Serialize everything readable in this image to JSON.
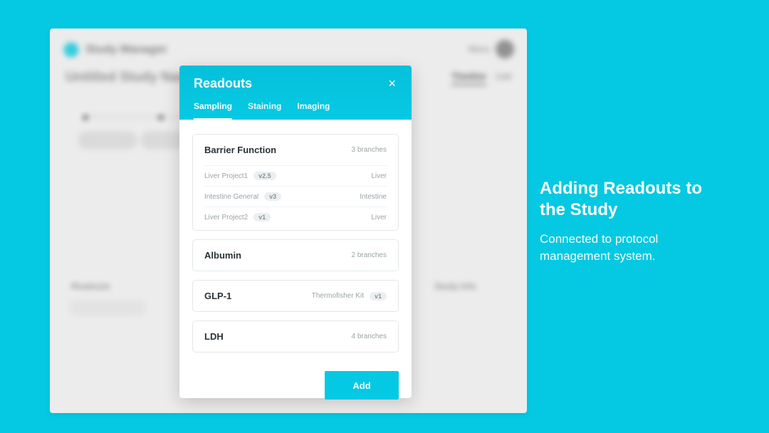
{
  "caption": {
    "title": "Adding Readouts to the Study",
    "subtitle": "Connected to protocol management system."
  },
  "bg": {
    "app_name": "Study Manager",
    "menu_label": "Menu",
    "doc_title": "Untitled Study Name",
    "right_tabs": {
      "active": "Timeline",
      "inactive": "List"
    },
    "section_readouts": "Readouts",
    "section_studyinfo": "Study Info"
  },
  "modal": {
    "title": "Readouts",
    "tabs": [
      {
        "key": "sampling",
        "label": "Sampling",
        "active": true
      },
      {
        "key": "staining",
        "label": "Staining",
        "active": false
      },
      {
        "key": "imaging",
        "label": "Imaging",
        "active": false
      }
    ],
    "cards": [
      {
        "title": "Barrier Function",
        "meta": "3 branches",
        "expanded": true,
        "branches": [
          {
            "name": "Liver Project1",
            "version": "v2.5",
            "tag": "Liver"
          },
          {
            "name": "Intestine General",
            "version": "v3",
            "tag": "Intestine"
          },
          {
            "name": "Liver Project2",
            "version": "v1",
            "tag": "Liver"
          }
        ]
      },
      {
        "title": "Albumin",
        "meta": "2 branches",
        "expanded": false
      },
      {
        "title": "GLP-1",
        "kit": "Thermofisher Kit",
        "kit_version": "v1",
        "expanded": false
      },
      {
        "title": "LDH",
        "meta": "4 branches",
        "expanded": false
      }
    ],
    "add_label": "Add"
  }
}
